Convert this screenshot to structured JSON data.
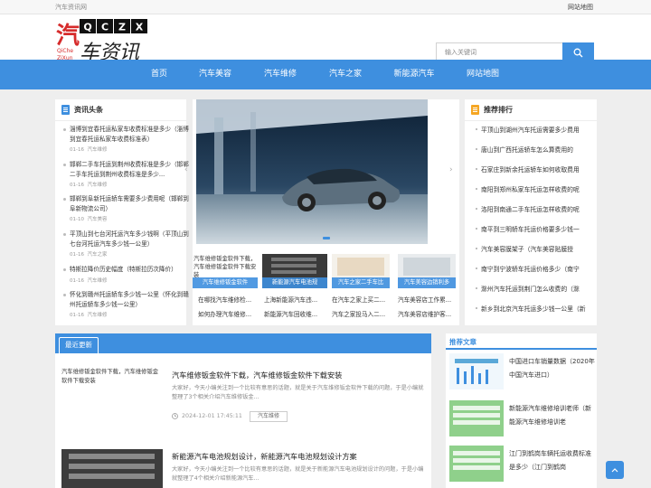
{
  "topbar": {
    "site_name": "汽车资讯网",
    "sitemap": "网站地图"
  },
  "logo": {
    "letters": "QCZX",
    "main": "车资讯",
    "sub1": "QiChe",
    "sub2": "ZiXun"
  },
  "search": {
    "placeholder": "输入关键词"
  },
  "nav": [
    "首页",
    "汽车美容",
    "汽车维修",
    "汽车之家",
    "新能源汽车",
    "网站地图"
  ],
  "news_panel": {
    "title": "资讯头条",
    "items": [
      {
        "text": "淄博到宜春托运私家车收费标准是多少（淄博到宜春托运私家车收费标准表）",
        "date": "01-16",
        "cat": "汽车维修"
      },
      {
        "text": "邯郸二手车托运到荆州收费标准是多少（邯郸二手车托运到荆州收费标准是多少...",
        "date": "01-16",
        "cat": "汽车维修"
      },
      {
        "text": "邯郸到阜新托运轿车需要多少费用呢（邯郸到阜新物流公司）",
        "date": "01-10",
        "cat": "汽车美容"
      },
      {
        "text": "平顶山到七台河托运汽车多少钱啊（平顶山到七台河托运汽车多少钱一公里）",
        "date": "01-16",
        "cat": "汽车之家"
      },
      {
        "text": "特斯拉降价历史幅度（特斯拉历次降价）",
        "date": "01-16",
        "cat": "汽车维修"
      },
      {
        "text": "怀化到赣州托运轿车多少钱一公里（怀化到赣州托运轿车多少钱一公里）",
        "date": "01-16",
        "cat": "汽车维修"
      }
    ]
  },
  "slider": {
    "thumbs": [
      {
        "label": "汽车维修钣金软件",
        "alt": "汽车维修钣金软件下载，汽车维修钣金软件下载安装"
      },
      {
        "label": "新能源汽车电池规"
      },
      {
        "label": "汽车之家二手车比"
      },
      {
        "label": "汽车美容边销利多"
      }
    ],
    "links_row1": [
      "在哪找汽车维修检...",
      "上海新能源汽车违...",
      "在汽车之家上买二...",
      "汽车美容店工作累..."
    ],
    "links_row2": [
      "如何办理汽车维修...",
      "新能源汽车回收维...",
      "汽车之家投马入二...",
      "汽车美容店维护客..."
    ]
  },
  "rank_panel": {
    "title": "推荐排行",
    "items": [
      "平顶山到湖州汽车托运需要多少费用",
      "唐山到广西托运轿车怎么算费用的",
      "石家庄到新余托运轿车如何收取费用",
      "南阳到郑州私家车托运怎样收费的呢",
      "洛阳到南通二手车托运怎样收费的呢",
      "南平到三明轿车托运价格要多少钱一",
      "汽车美容膜架子（汽车美容贴膜授",
      "南宁到宁波轿车托运价格多少（南宁",
      "滁州汽车托运到荆门怎么收费的（滁",
      "新乡到北京汽车托运多少钱一公里（新"
    ]
  },
  "recent": {
    "tab": "最近更新",
    "articles": [
      {
        "thumb_alt": "汽车维修钣金软件下载，汽车维修钣金软件下载安装",
        "title": "汽车维修钣金软件下载，汽车维修钣金软件下载安装",
        "desc": "大家好，今天小编关注到一个比较有意思的话题，就是关于汽车维修钣金软件下载的问题，于是小编就整理了3个相关介绍汽车维修钣金...",
        "date": "2024-12-01 17:45:11",
        "tag": "汽车维修"
      },
      {
        "thumb_alt": "新能源汽车电池规划设计",
        "title": "新能源汽车电池规划设计，新能源汽车电池规划设计方案",
        "desc": "大家好，今天小编关注到一个比较有意思的话题，就是关于新能源汽车电池规划设计的问题，于是小编就整理了4个相关介绍新能源汽车..."
      }
    ]
  },
  "recommend": {
    "title": "推荐文章",
    "items": [
      "中国进口车销量数据（2020年中国汽车进口）",
      "新能源汽车维修培训老师（新能源汽车维修培训老",
      "江门到鹤岗车辆托运收费标准是多少（江门到鹤岗"
    ]
  },
  "colors": {
    "accent": "#3e8fdf",
    "logo_red": "#d62b2b"
  }
}
